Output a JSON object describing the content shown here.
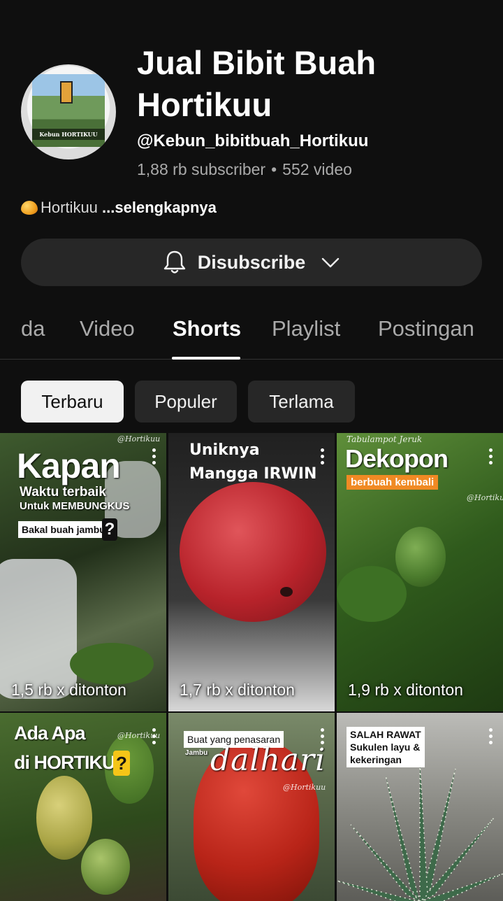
{
  "channel": {
    "name": "Jual Bibit Buah Hortikuu",
    "handle": "@Kebun_bibitbuah_Hortikuu",
    "subscribers": "1,88 rb subscriber",
    "videos": "552 video",
    "stats_separator": "•",
    "description": "Hortikuu",
    "more_label": "...selengkapnya",
    "avatar_text": "Kebun HORTIKUU"
  },
  "subscribe_button": {
    "label": "Disubscribe"
  },
  "tabs": [
    {
      "label": "da"
    },
    {
      "label": "Video"
    },
    {
      "label": "Shorts",
      "active": true
    },
    {
      "label": "Playlist"
    },
    {
      "label": "Postingan"
    }
  ],
  "chips": [
    {
      "label": "Terbaru",
      "selected": true
    },
    {
      "label": "Populer"
    },
    {
      "label": "Terlama"
    }
  ],
  "shorts": [
    {
      "views": "1,5 rb x ditonton",
      "title_big": "Kapan",
      "line2": "Waktu terbaik",
      "line3": "Untuk MEMBUNGKUS",
      "line4": "Bakal buah jambu",
      "qmark": "?",
      "watermark": "@Hortikuu"
    },
    {
      "views": "1,7 rb x ditonton",
      "line1": "Uniknya",
      "line2": "Mangga IRWIN"
    },
    {
      "views": "1,9 rb x ditonton",
      "line1": "Tabulampot Jeruk",
      "title_big": "Dekopon",
      "badge": "berbuah kembali",
      "watermark": "@Hortikuu"
    },
    {
      "views": "",
      "line1": "Ada Apa",
      "line2": "di HORTIKUU",
      "qmark": "?",
      "watermark": "@Hortikuu"
    },
    {
      "views": "",
      "box": "Buat yang penasaran",
      "small": "Jambu",
      "script_title": "dalhari",
      "watermark": "@Hortikuu"
    },
    {
      "views": "",
      "box": "SALAH RAWAT\nSukulen layu &\nkekeringan"
    }
  ],
  "colors": {
    "background": "#0f0f0f",
    "button": "#272727",
    "orange_badge": "#f08a24"
  }
}
